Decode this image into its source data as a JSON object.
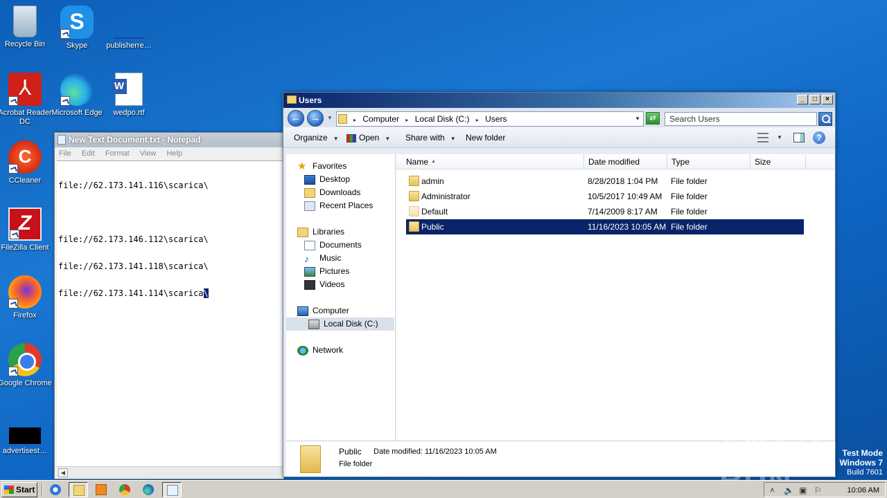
{
  "desktop": {
    "icons": [
      {
        "label": "Recycle Bin",
        "icon": "recycle-bin-icon"
      },
      {
        "label": "Skype",
        "icon": "skype-icon",
        "glyph": "S"
      },
      {
        "label": "publisherre…",
        "icon": "blank-file-icon"
      },
      {
        "label": "Acrobat Reader DC",
        "icon": "acrobat-icon",
        "glyph": "⅄"
      },
      {
        "label": "Microsoft Edge",
        "icon": "edge-icon"
      },
      {
        "label": "wedpo.rtf",
        "icon": "word-document-icon",
        "glyph": "W"
      },
      {
        "label": "CCleaner",
        "icon": "ccleaner-icon",
        "glyph": "C"
      },
      {
        "label": "FileZilla Client",
        "icon": "filezilla-icon",
        "glyph": "Z"
      },
      {
        "label": "Firefox",
        "icon": "firefox-icon"
      },
      {
        "label": "Google Chrome",
        "icon": "chrome-icon"
      },
      {
        "label": "advertisest…",
        "icon": "black-file-icon"
      }
    ]
  },
  "notepad": {
    "title": "New Text Document.txt - Notepad",
    "menu": [
      "File",
      "Edit",
      "Format",
      "View",
      "Help"
    ],
    "lines": [
      "file://62.173.141.116\\scarica\\",
      "",
      "file://62.173.146.112\\scarica\\",
      "file://62.173.141.118\\scarica\\",
      "file://62.173.141.114\\scarica"
    ],
    "selected_char": "\\"
  },
  "explorer": {
    "title": "Users",
    "window_buttons": {
      "minimize": "_",
      "maximize": "□",
      "close": "×"
    },
    "address": {
      "crumbs": [
        "Computer",
        "Local Disk (C:)",
        "Users"
      ],
      "sep": "▸",
      "dropdown": "▼"
    },
    "search_placeholder": "Search Users",
    "toolbar": {
      "organize": "Organize",
      "open": "Open",
      "share_with": "Share with",
      "new_folder": "New folder",
      "dropdown_glyph": "▼",
      "help": "?"
    },
    "nav": {
      "favorites": "Favorites",
      "desktop": "Desktop",
      "downloads": "Downloads",
      "recent_places": "Recent Places",
      "libraries": "Libraries",
      "documents": "Documents",
      "music": "Music",
      "pictures": "Pictures",
      "videos": "Videos",
      "computer": "Computer",
      "local_disk": "Local Disk (C:)",
      "network": "Network"
    },
    "columns": {
      "name": "Name",
      "date": "Date modified",
      "type": "Type",
      "size": "Size",
      "sort": "▲"
    },
    "rows": [
      {
        "name": "admin",
        "date": "8/28/2018 1:04 PM",
        "type": "File folder"
      },
      {
        "name": "Administrator",
        "date": "10/5/2017 10:49 AM",
        "type": "File folder"
      },
      {
        "name": "Default",
        "date": "7/14/2009 8:17 AM",
        "type": "File folder"
      },
      {
        "name": "Public",
        "date": "11/16/2023 10:05 AM",
        "type": "File folder"
      }
    ],
    "selected_row": "Public",
    "details": {
      "name": "Public",
      "modified": "Date modified:  11/16/2023 10:05 AM",
      "type": "File folder"
    }
  },
  "watermark": "ANY ▷ RUN",
  "test_mode": {
    "line1": "Test Mode",
    "line2": "Windows 7",
    "line3": "Build 7601"
  },
  "taskbar": {
    "start_label": "Start",
    "clock": "10:06 AM",
    "tray_glyphs": {
      "chevron": "˄",
      "volume": "🔈",
      "network": "▣",
      "flag": "⚐"
    }
  }
}
